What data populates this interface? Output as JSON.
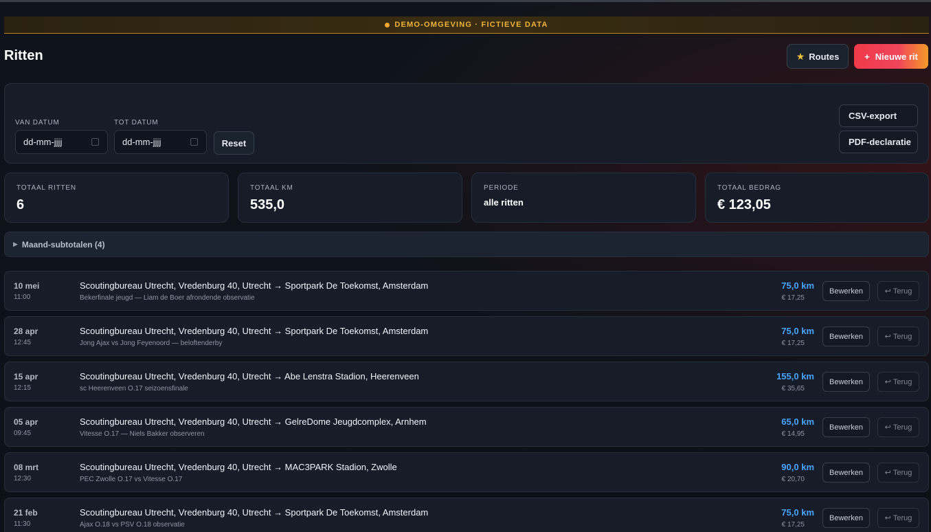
{
  "banner": {
    "text": "DEMO-OMGEVING · FICTIEVE DATA"
  },
  "header": {
    "title": "Ritten",
    "routes_label": "Routes",
    "new_trip_label": "Nieuwe rit"
  },
  "filters": {
    "from_label": "VAN DATUM",
    "from_placeholder": "dd-mm-jjjj",
    "to_label": "TOT DATUM",
    "to_placeholder": "dd-mm-jjjj",
    "reset_label": "Reset",
    "csv_label": "CSV-export",
    "pdf_label": "PDF-declaratie"
  },
  "stats": {
    "total_trips_label": "TOTAAL RITTEN",
    "total_trips": "6",
    "total_km_label": "TOTAAL KM",
    "total_km": "535,0",
    "period_label": "PERIODE",
    "period": "alle ritten",
    "total_amount_label": "TOTAAL BEDRAG",
    "total_amount": "€ 123,05"
  },
  "monthly": {
    "label": "Maand-subtotalen (4)"
  },
  "actions": {
    "edit": "Bewerken",
    "back": "Terug"
  },
  "trips": [
    {
      "date": "10 mei",
      "time": "11:00",
      "route": "Scoutingbureau Utrecht, Vredenburg 40, Utrecht → Sportpark De Toekomst, Amsterdam",
      "note": "Bekerfinale jeugd — Liam de Boer afrondende observatie",
      "km": "75,0 km",
      "amount": "€ 17,25"
    },
    {
      "date": "28 apr",
      "time": "12:45",
      "route": "Scoutingbureau Utrecht, Vredenburg 40, Utrecht → Sportpark De Toekomst, Amsterdam",
      "note": "Jong Ajax vs Jong Feyenoord — beloftenderby",
      "km": "75,0 km",
      "amount": "€ 17,25"
    },
    {
      "date": "15 apr",
      "time": "12:15",
      "route": "Scoutingbureau Utrecht, Vredenburg 40, Utrecht → Abe Lenstra Stadion, Heerenveen",
      "note": "sc Heerenveen O.17 seizoensfinale",
      "km": "155,0 km",
      "amount": "€ 35,65"
    },
    {
      "date": "05 apr",
      "time": "09:45",
      "route": "Scoutingbureau Utrecht, Vredenburg 40, Utrecht → GelreDome Jeugdcomplex, Arnhem",
      "note": "Vitesse O.17 — Niels Bakker observeren",
      "km": "65,0 km",
      "amount": "€ 14,95"
    },
    {
      "date": "08 mrt",
      "time": "12:30",
      "route": "Scoutingbureau Utrecht, Vredenburg 40, Utrecht → MAC3PARK Stadion, Zwolle",
      "note": "PEC Zwolle O.17 vs Vitesse O.17",
      "km": "90,0 km",
      "amount": "€ 20,70"
    },
    {
      "date": "21 feb",
      "time": "11:30",
      "route": "Scoutingbureau Utrecht, Vredenburg 40, Utrecht → Sportpark De Toekomst, Amsterdam",
      "note": "Ajax O.18 vs PSV O.18 observatie",
      "km": "75,0 km",
      "amount": "€ 17,25"
    }
  ]
}
